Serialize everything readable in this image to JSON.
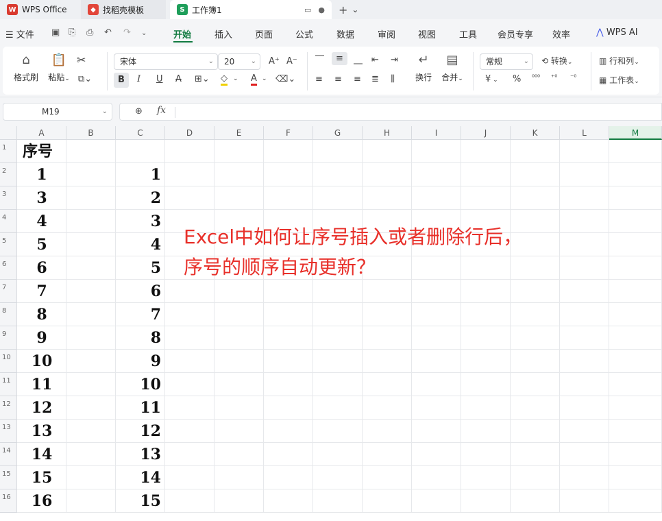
{
  "tabs": {
    "wps": "WPS Office",
    "template": "找稻壳模板",
    "workbook": "工作簿1",
    "new_tab": "+",
    "new_tab_dropdown": "⌄"
  },
  "menu": {
    "file": "文件",
    "items": [
      "开始",
      "插入",
      "页面",
      "公式",
      "数据",
      "审阅",
      "视图",
      "工具",
      "会员专享",
      "效率"
    ],
    "wps_ai": "WPS AI"
  },
  "ribbon": {
    "format_painter": "格式刷",
    "paste": "粘贴",
    "font_name": "宋体",
    "font_size": "20",
    "wrap": "换行",
    "merge": "合并",
    "number_format": "常规",
    "convert": "转换",
    "row_col": "行和列",
    "worksheet": "工作表",
    "currency": "¥",
    "percent": "%",
    "bold": "B",
    "italic": "I",
    "underline": "U",
    "strike": "A"
  },
  "formula_bar": {
    "name_box": "M19",
    "fx": "fx",
    "formula": ""
  },
  "columns": [
    "A",
    "B",
    "C",
    "D",
    "E",
    "F",
    "G",
    "H",
    "I",
    "J",
    "K",
    "L",
    "M"
  ],
  "selected_column": "M",
  "rows": [
    "1",
    "2",
    "3",
    "4",
    "5",
    "6",
    "7",
    "8",
    "9",
    "10",
    "11",
    "12",
    "13",
    "14",
    "15",
    "16"
  ],
  "col_a": [
    "序号",
    "1",
    "3",
    "4",
    "5",
    "6",
    "7",
    "8",
    "9",
    "10",
    "11",
    "12",
    "13",
    "14",
    "15",
    "16"
  ],
  "col_c": [
    "",
    "1",
    "2",
    "3",
    "4",
    "5",
    "6",
    "7",
    "8",
    "9",
    "10",
    "11",
    "12",
    "13",
    "14",
    "15"
  ],
  "annotation": {
    "line1": "Excel中如何让序号插入或者删除行后，",
    "line2": "序号的顺序自动更新？"
  },
  "colors": {
    "accent": "#117a40",
    "annotation": "#e8302a",
    "wps_red": "#d93a2f",
    "sheet_green": "#1e9e5a"
  }
}
